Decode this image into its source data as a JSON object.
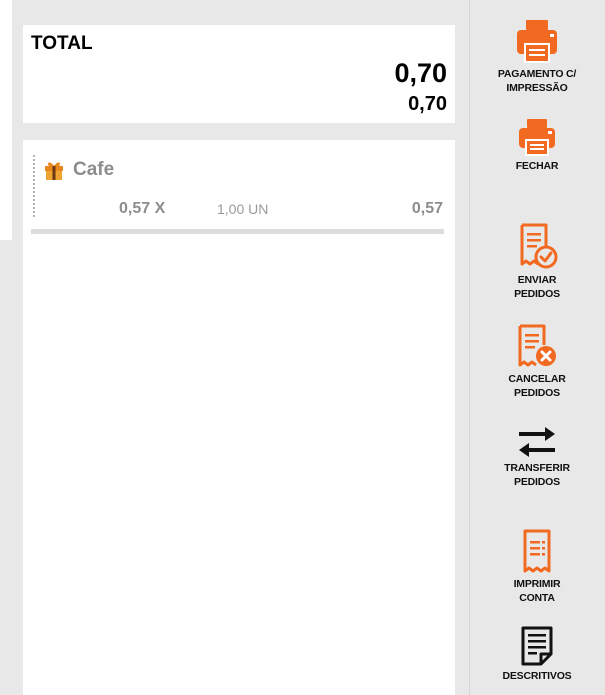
{
  "colors": {
    "accent": "#f26a21",
    "background": "#e8e8e8",
    "muted_text": "#8d8d8d"
  },
  "total": {
    "label": "TOTAL",
    "value": "0,70",
    "sub_value": "0,70"
  },
  "items": [
    {
      "icon": "gift-icon",
      "name": "Cafe",
      "unit_price": "0,57 X",
      "quantity": "1,00 UN",
      "line_total": "0,57"
    }
  ],
  "actions": [
    {
      "icon": "printer-icon",
      "label": "PAGAMENTO C/\nIMPRESSÃO"
    },
    {
      "icon": "printer-icon",
      "label": "FECHAR"
    },
    {
      "icon": "receipt-check-icon",
      "label": "ENVIAR\nPEDIDOS"
    },
    {
      "icon": "receipt-cancel-icon",
      "label": "CANCELAR\nPEDIDOS"
    },
    {
      "icon": "transfer-arrows-icon",
      "label": "TRANSFERIR\nPEDIDOS"
    },
    {
      "icon": "receipt-icon",
      "label": "IMPRIMIR\nCONTA"
    },
    {
      "icon": "document-list-icon",
      "label": "DESCRITIVOS"
    }
  ]
}
